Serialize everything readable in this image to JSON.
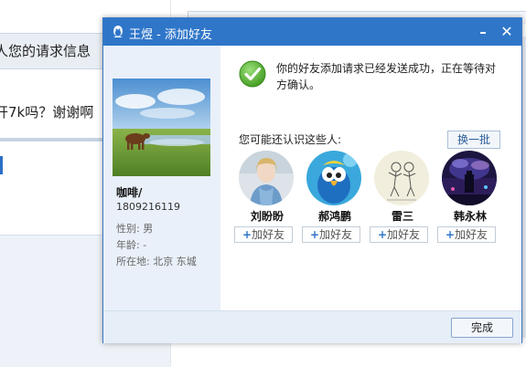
{
  "background": {
    "chat_line_1": "人您的请求信息",
    "chat_line_2": "开7k吗？谢谢啊"
  },
  "dialog": {
    "title": "王煜 - 添加好友",
    "minimize_glyph": "–",
    "close_glyph": "✕"
  },
  "profile": {
    "nickname": "咖啡/",
    "qq_number": "1809216119",
    "gender": "性别: 男",
    "age": "年龄: -",
    "location": "所在地: 北京 东城"
  },
  "status": {
    "message": "你的好友添加请求已经发送成功，正在等待对方确认。",
    "icon": "check-circle-icon",
    "color": "#4caf50"
  },
  "recommend": {
    "label": "您可能还认识这些人:",
    "refresh_label": "换一批",
    "people": [
      {
        "name": "刘盼盼",
        "add_label": "加好友"
      },
      {
        "name": "郝鸿鹏",
        "add_label": "加好友"
      },
      {
        "name": "雷三",
        "add_label": "加好友"
      },
      {
        "name": "韩永林",
        "add_label": "加好友"
      }
    ]
  },
  "footer": {
    "done_label": "完成"
  },
  "colors": {
    "titlebar": "#2f76c9",
    "profile_bg": "#e9f0f9",
    "footer_bg": "#e6eef8"
  }
}
